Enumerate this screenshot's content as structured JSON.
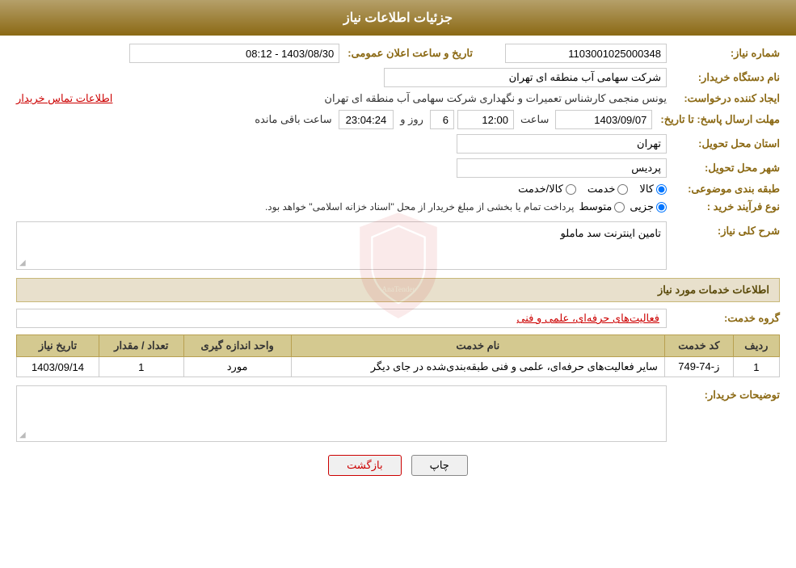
{
  "header": {
    "title": "جزئیات اطلاعات نیاز"
  },
  "fields": {
    "need_number_label": "شماره نیاز:",
    "need_number_value": "1103001025000348",
    "announce_date_label": "تاریخ و ساعت اعلان عمومی:",
    "announce_date_value": "1403/08/30 - 08:12",
    "buyer_org_label": "نام دستگاه خریدار:",
    "buyer_org_value": "شرکت سهامی آب منطقه ای تهران",
    "creator_label": "ایجاد کننده درخواست:",
    "creator_value": "یونس منجمی کارشناس تعمیرات و نگهداری شرکت سهامی آب منطقه ای تهران",
    "contact_link": "اطلاعات تماس خریدار",
    "response_deadline_label": "مهلت ارسال پاسخ: تا تاریخ:",
    "response_date_value": "1403/09/07",
    "response_time_label": "ساعت",
    "response_time_value": "12:00",
    "response_days_label": "روز و",
    "response_days_value": "6",
    "response_countdown_label": "ساعت باقی مانده",
    "response_countdown_value": "23:04:24",
    "province_label": "استان محل تحویل:",
    "province_value": "تهران",
    "city_label": "شهر محل تحویل:",
    "city_value": "پردیس",
    "category_label": "طبقه بندی موضوعی:",
    "category_option1": "کالا",
    "category_option2": "خدمت",
    "category_option3": "کالا/خدمت",
    "category_selected": "کالا",
    "purchase_type_label": "نوع فرآیند خرید :",
    "purchase_type_options": [
      "جزیی",
      "متوسط"
    ],
    "purchase_type_selected": "جزیی",
    "purchase_type_note": "پرداخت تمام یا بخشی از مبلغ خریدار از محل \"اسناد خزانه اسلامی\" خواهد بود.",
    "description_label": "شرح کلی نیاز:",
    "description_value": "تامین اینترنت سد ماملو",
    "services_section_label": "اطلاعات خدمات مورد نیاز",
    "group_service_label": "گروه خدمت:",
    "group_service_value": "فعالیت‌های حرفه‌ای، علمی و فنی",
    "table_columns": [
      "ردیف",
      "کد خدمت",
      "نام خدمت",
      "واحد اندازه گیری",
      "تعداد / مقدار",
      "تاریخ نیاز"
    ],
    "table_rows": [
      {
        "row": "1",
        "code": "ز-74-749",
        "name": "سایر فعالیت‌های حرفه‌ای، علمی و فنی طبقه‌بندی‌شده در جای دیگر",
        "unit": "مورد",
        "quantity": "1",
        "date": "1403/09/14"
      }
    ],
    "buyer_notes_label": "توضیحات خریدار:",
    "buyer_notes_value": "",
    "btn_print": "چاپ",
    "btn_back": "بازگشت"
  }
}
